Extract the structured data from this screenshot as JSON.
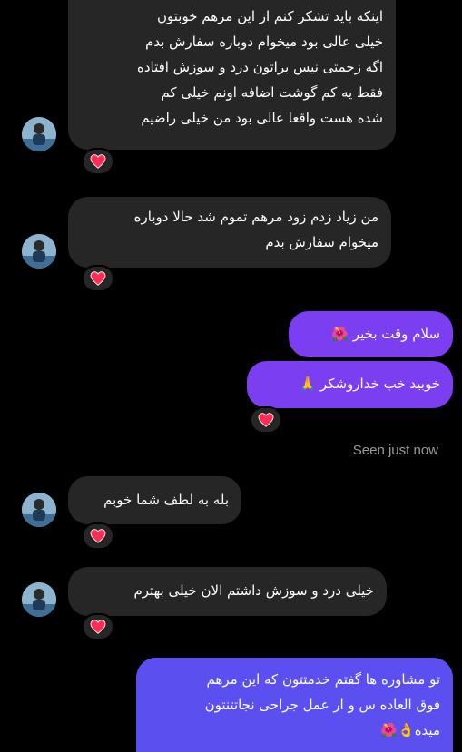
{
  "messages": [
    {
      "id": "m1",
      "direction": "incoming",
      "lines": [
        "اینکه باید تشکر کنم از این مرهم خوبتون",
        "خیلی عالی بود میخوام دوباره سفارش بدم",
        "اگه زحمتی نیس براتون درد و سوزش افتاده",
        "فقط یه کم گوشت اضافه اونم خیلی کم",
        "شده هست واقعا عالی بود من خیلی راضیم"
      ],
      "reaction": "heart"
    },
    {
      "id": "m2",
      "direction": "incoming",
      "lines": [
        "من زیاد زدم زود مرهم تموم شد حالا دوباره",
        "میخوام سفارش بدم"
      ],
      "reaction": "heart"
    },
    {
      "id": "m3",
      "direction": "outgoing",
      "lines": [
        "سلام وقت بخیر 🌺"
      ]
    },
    {
      "id": "m4",
      "direction": "outgoing",
      "lines": [
        "خوبید خب خداروشکر 🙏"
      ],
      "reaction": "heart"
    },
    {
      "id": "m5",
      "direction": "incoming",
      "lines": [
        "بله به لطف شما خوبم"
      ],
      "reaction": "heart"
    },
    {
      "id": "m6",
      "direction": "incoming",
      "lines": [
        "خیلی درد و سوزش داشتم الان خیلی بهترم"
      ],
      "reaction": "heart"
    },
    {
      "id": "m7",
      "direction": "outgoing",
      "lines": [
        "تو مشاوره ها گفتم خدمتتون که این مرهم",
        "فوق العاده س و ار عمل جراحی نجاتتنتون",
        "میده👌🌺"
      ]
    }
  ],
  "status": {
    "seen_text": "Seen just now"
  },
  "colors": {
    "background": "#000000",
    "incoming_bubble": "#262626",
    "outgoing_bubble": "#7b3ef0",
    "outgoing_bubble_blue": "#5b4ff0",
    "seen_text": "#9a9a9a",
    "heart": "#ff2d55"
  },
  "icons": {
    "reaction": "heart-icon",
    "avatar": "user-avatar"
  }
}
